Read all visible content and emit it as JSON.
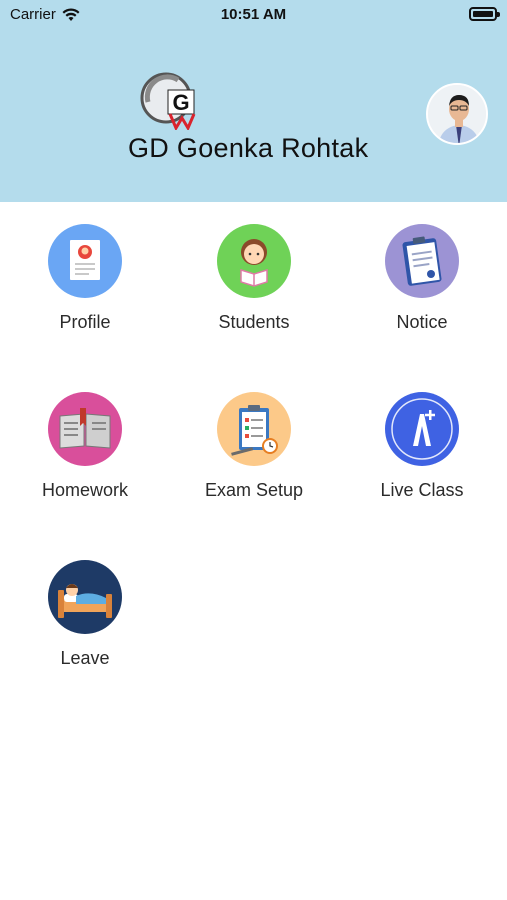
{
  "status_bar": {
    "carrier": "Carrier",
    "time": "10:51 AM"
  },
  "header": {
    "school_name": "GD Goenka Rohtak"
  },
  "menu": {
    "items": [
      {
        "label": "Profile",
        "icon": "profile-card-icon",
        "color": "#6aa6f4"
      },
      {
        "label": "Students",
        "icon": "student-reading-icon",
        "color": "#6fd257"
      },
      {
        "label": "Notice",
        "icon": "clipboard-notice-icon",
        "color": "#9c93d4"
      },
      {
        "label": "Homework",
        "icon": "open-book-icon",
        "color": "#d94f9b"
      },
      {
        "label": "Exam Setup",
        "icon": "exam-checklist-icon",
        "color": "#fcc989"
      },
      {
        "label": "Live Class",
        "icon": "live-class-icon",
        "color": "#3f62e3"
      },
      {
        "label": "Leave",
        "icon": "sleeping-bed-icon",
        "color": "#1e3a66"
      }
    ]
  }
}
